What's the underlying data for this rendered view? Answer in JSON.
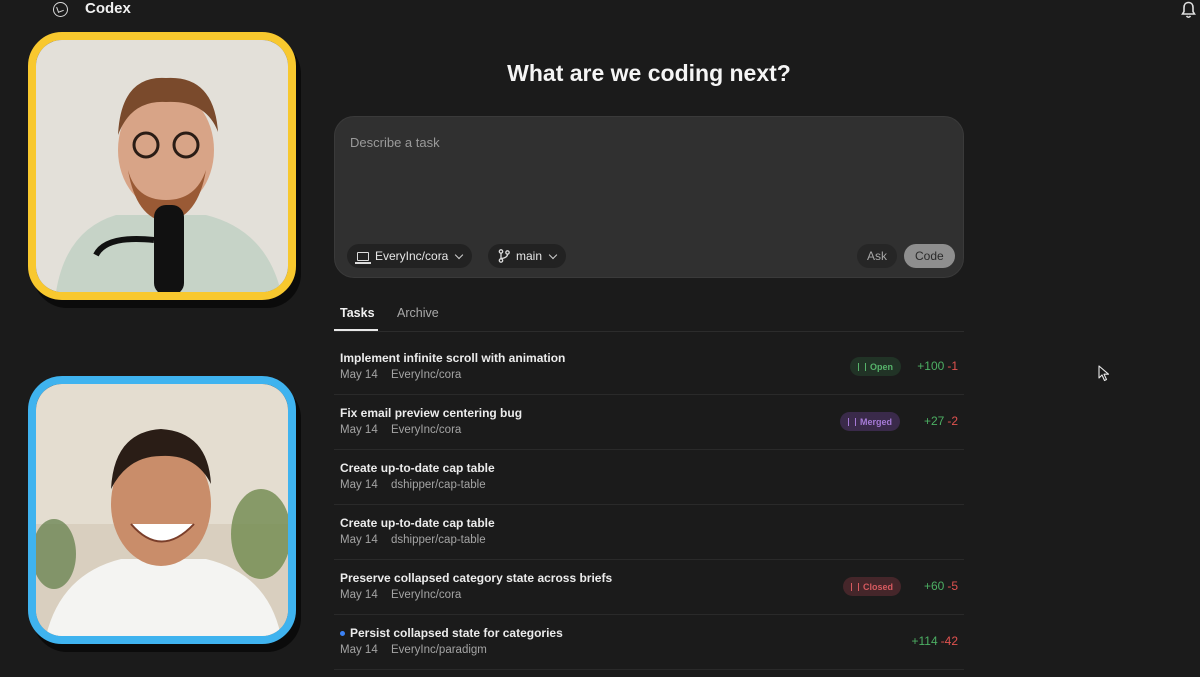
{
  "app": {
    "title": "Codex"
  },
  "headline": "What are we coding next?",
  "composer": {
    "placeholder": "Describe a task",
    "repo": "EveryInc/cora",
    "branch": "main",
    "ask_label": "Ask",
    "code_label": "Code"
  },
  "tabs": [
    {
      "label": "Tasks",
      "active": true
    },
    {
      "label": "Archive",
      "active": false
    }
  ],
  "tasks": [
    {
      "title": "Implement infinite scroll with animation",
      "date": "May 14",
      "repo": "EveryInc/cora",
      "status": "Open",
      "additions": "+100",
      "deletions": "-1"
    },
    {
      "title": "Fix email preview centering bug",
      "date": "May 14",
      "repo": "EveryInc/cora",
      "status": "Merged",
      "additions": "+27",
      "deletions": "-2"
    },
    {
      "title": "Create up-to-date cap table",
      "date": "May 14",
      "repo": "dshipper/cap-table"
    },
    {
      "title": "Create up-to-date cap table",
      "date": "May 14",
      "repo": "dshipper/cap-table"
    },
    {
      "title": "Preserve collapsed category state across briefs",
      "date": "May 14",
      "repo": "EveryInc/cora",
      "status": "Closed",
      "additions": "+60",
      "deletions": "-5"
    },
    {
      "title": "Persist collapsed state for categories",
      "date": "May 14",
      "repo": "EveryInc/paradigm",
      "unread": true,
      "additions": "+114",
      "deletions": "-42"
    }
  ],
  "colors": {
    "background": "#1b1b1b",
    "tile_yellow": "#f8c82e",
    "tile_blue": "#3fb3ef",
    "status_open": "#56b36a",
    "status_merged": "#a57ad6",
    "status_closed": "#d65a5f",
    "diff_add": "#4caf63",
    "diff_del": "#e0524f"
  },
  "icons": [
    "codex-logo-icon",
    "bell-icon",
    "laptop-icon",
    "branch-icon",
    "chevron-down-icon",
    "pull-request-icon",
    "mouse-cursor-icon"
  ]
}
